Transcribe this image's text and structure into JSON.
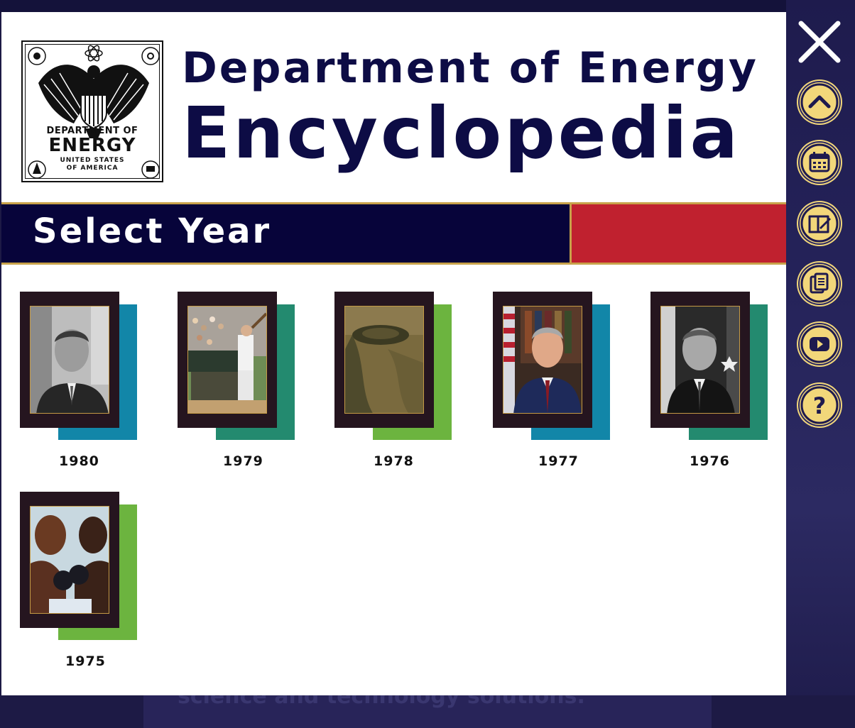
{
  "background": {
    "bottom_text": "science and technology solutions."
  },
  "header": {
    "seal": {
      "line1": "DEPARTMENT OF",
      "line2": "ENERGY",
      "line3": "UNITED STATES",
      "line4": "OF AMERICA"
    },
    "title_line1": "Department of Energy",
    "title_line2": "Encyclopedia"
  },
  "banner": {
    "title": "Select Year",
    "accent_color": "#c0212f"
  },
  "years": [
    {
      "label": "1980",
      "back_color": "#1286a8",
      "photo": "portrait-bw"
    },
    {
      "label": "1979",
      "back_color": "#238a6f",
      "photo": "baseball"
    },
    {
      "label": "1978",
      "back_color": "#6cb43f",
      "photo": "aerial-landscape"
    },
    {
      "label": "1977",
      "back_color": "#1286a8",
      "photo": "portrait-flag"
    },
    {
      "label": "1976",
      "back_color": "#238a6f",
      "photo": "portrait-bw"
    },
    {
      "label": "1975",
      "back_color": "#6cb43f",
      "photo": "boxing"
    }
  ],
  "sidebar": {
    "buttons": [
      {
        "icon": "close-icon"
      },
      {
        "icon": "chevron-up-icon"
      },
      {
        "icon": "calendar-icon"
      },
      {
        "icon": "book-edit-icon"
      },
      {
        "icon": "documents-icon"
      },
      {
        "icon": "video-icon"
      },
      {
        "icon": "help-icon"
      }
    ],
    "button_color": "#f2d77a"
  }
}
